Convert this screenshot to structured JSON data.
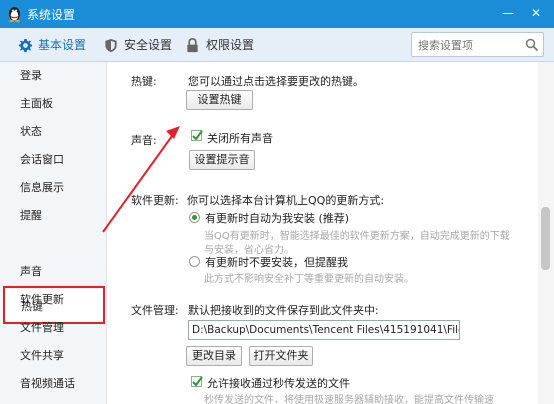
{
  "window": {
    "title": "系统设置",
    "minimize_glyph": "—",
    "close_glyph": "✕"
  },
  "tabs": [
    {
      "label": "基本设置",
      "icon": "gear-icon",
      "active": true
    },
    {
      "label": "安全设置",
      "icon": "shield-icon",
      "active": false
    },
    {
      "label": "权限设置",
      "icon": "lock-icon",
      "active": false
    }
  ],
  "search": {
    "placeholder": "搜索设置项",
    "icon": "search-icon"
  },
  "sidebar": {
    "items": [
      "登录",
      "主面板",
      "状态",
      "会话窗口",
      "信息展示",
      "提醒",
      "热键",
      "声音",
      "软件更新",
      "文件管理",
      "文件共享",
      "音视频通话"
    ],
    "selected": "热键",
    "highlight_color": "#e0232b"
  },
  "hotkey": {
    "label": "热键:",
    "desc": "您可以通过点击选择要更改的热键。",
    "button": "设置热键"
  },
  "sound": {
    "label": "声音:",
    "mute_all": "关闭所有声音",
    "button": "设置提示音"
  },
  "update": {
    "label": "软件更新:",
    "desc": "你可以选择本台计算机上QQ的更新方式:",
    "auto": {
      "label": "有更新时自动为我安装 (推荐)",
      "hint_line1": "当QQ有更新时，智能选择最佳的软件更新方案，自动完成更新的下载",
      "hint_line2": "与安装，省心省力。"
    },
    "manual": {
      "label": "有更新时不要安装，但提醒我",
      "hint": "此方式不影响安全补丁等重要更新的自动安装。"
    }
  },
  "files": {
    "label": "文件管理:",
    "desc": "默认把接收到的文件保存到此文件夹中:",
    "path": "D:\\Backup\\Documents\\Tencent Files\\415191041\\FileRecv\\",
    "change_button": "更改目录",
    "open_button": "打开文件夹",
    "fast_transfer": "允许接收通过秒传发送的文件",
    "fast_hint": "秒传发送的文件，将使用极速服务器辅助接收，能提高文件传输速"
  },
  "colors": {
    "titlebar": "#1a8cd8",
    "accent": "#1a6fb9",
    "annotation": "#e0232b",
    "check": "#2a9a2a"
  }
}
